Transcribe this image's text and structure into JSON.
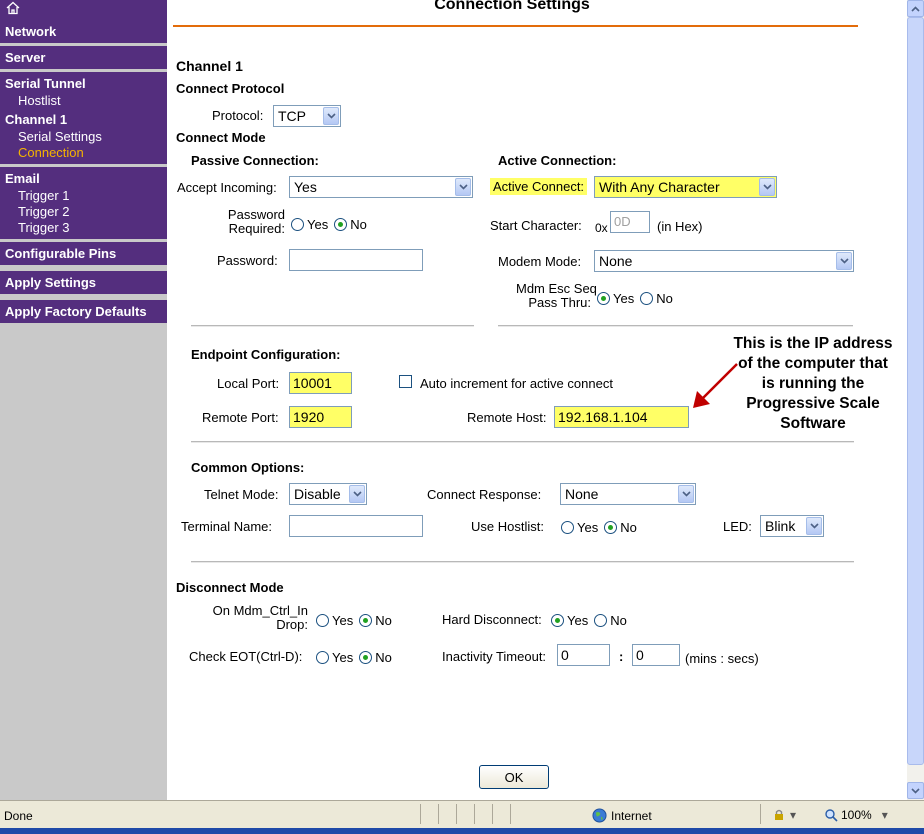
{
  "sidebar": {
    "groups": [
      {
        "header": "Network"
      },
      {
        "header": "Server"
      },
      {
        "header": "Serial Tunnel",
        "items": [
          "Hostlist"
        ],
        "sub_header": "Channel 1",
        "sub_items": [
          "Serial Settings",
          "Connection"
        ],
        "active": "Connection"
      },
      {
        "header": "Email",
        "items": [
          "Trigger 1",
          "Trigger 2",
          "Trigger 3"
        ]
      },
      {
        "header": "Configurable Pins"
      },
      {
        "header": "Apply Settings"
      },
      {
        "header": "Apply Factory Defaults"
      }
    ]
  },
  "page": {
    "title": "Connection Settings",
    "channel": "Channel 1",
    "connect_protocol": {
      "heading": "Connect Protocol",
      "label": "Protocol:",
      "value": "TCP"
    },
    "connect_mode": {
      "heading": "Connect Mode",
      "passive": {
        "heading": "Passive Connection:",
        "accept_incoming_label": "Accept Incoming:",
        "accept_incoming_value": "Yes",
        "password_required_label_1": "Password",
        "password_required_label_2": "Required:",
        "password_required": "No",
        "password_label": "Password:",
        "password_value": ""
      },
      "active": {
        "heading": "Active Connection:",
        "active_connect_label": "Active Connect:",
        "active_connect_value": "With Any Character",
        "start_char_label": "Start Character:",
        "start_char_prefix": "0x",
        "start_char_value": "0D",
        "start_char_unit": "(in Hex)",
        "modem_mode_label": "Modem Mode:",
        "modem_mode_value": "None",
        "mdm_esc_label_1": "Mdm Esc Seq",
        "mdm_esc_label_2": "Pass Thru:",
        "mdm_esc": "Yes"
      }
    },
    "endpoint": {
      "heading": "Endpoint Configuration:",
      "local_port_label": "Local Port:",
      "local_port": "10001",
      "auto_increment_label": "Auto increment for active connect",
      "remote_port_label": "Remote Port:",
      "remote_port": "1920",
      "remote_host_label": "Remote Host:",
      "remote_host": "192.168.1.104"
    },
    "annotation": [
      "This is the IP address",
      "of the computer that",
      "is running the",
      "Progressive Scale",
      "Software"
    ],
    "common": {
      "heading": "Common Options:",
      "telnet_label": "Telnet Mode:",
      "telnet_value": "Disable",
      "connect_response_label": "Connect Response:",
      "connect_response_value": "None",
      "terminal_name_label": "Terminal Name:",
      "terminal_name_value": "",
      "use_hostlist_label": "Use Hostlist:",
      "use_hostlist": "No",
      "led_label": "LED:",
      "led_value": "Blink"
    },
    "disconnect": {
      "heading": "Disconnect Mode",
      "mdm_ctrl_label_1": "On Mdm_Ctrl_In",
      "mdm_ctrl_label_2": "Drop:",
      "mdm_ctrl": "No",
      "hard_disconnect_label": "Hard Disconnect:",
      "hard_disconnect": "Yes",
      "check_eot_label": "Check EOT(Ctrl-D):",
      "check_eot": "No",
      "inactivity_label": "Inactivity Timeout:",
      "inactivity_mins": "0",
      "inactivity_sep": ":",
      "inactivity_secs": "0",
      "inactivity_unit": "(mins : secs)"
    },
    "radio_yes": "Yes",
    "radio_no": "No",
    "ok_label": "OK"
  },
  "statusbar": {
    "status": "Done",
    "zone": "Internet",
    "zoom": "100%"
  },
  "colors": {
    "sidebar_bg": "#542e7e",
    "sidebar_active": "#f5b400",
    "title_rule": "#e36c0a",
    "highlight": "#ffff66"
  }
}
